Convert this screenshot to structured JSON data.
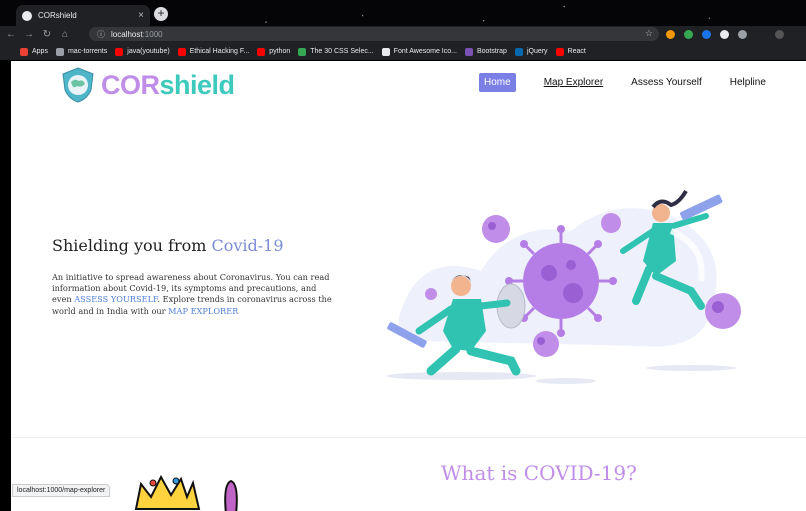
{
  "browser": {
    "tab_title": "CORshield",
    "tab_close": "×",
    "new_tab": "+",
    "url_host": "localhost",
    "url_rest": ":1000",
    "status_url": "localhost:1000/map-explorer",
    "nav_back": "←",
    "nav_forward": "→",
    "nav_reload": "↻",
    "nav_home": "⌂",
    "star": "☆"
  },
  "bookmarks": [
    {
      "label": "Apps",
      "color": "#ea4335"
    },
    {
      "label": "mac-torrents",
      "color": "#9aa0a6"
    },
    {
      "label": "java(youtube)",
      "color": "#ff0000"
    },
    {
      "label": "Ethical Hacking F...",
      "color": "#ff0000"
    },
    {
      "label": "python",
      "color": "#ff0000"
    },
    {
      "label": "The 30 CSS Selec...",
      "color": "#34a853"
    },
    {
      "label": "Font Awesome Ico...",
      "color": "#e8eaed"
    },
    {
      "label": "Bootstrap",
      "color": "#7952b3"
    },
    {
      "label": "jQuery",
      "color": "#0769ad"
    },
    {
      "label": "React",
      "color": "#ff0000"
    }
  ],
  "site": {
    "logo_part1": "COR",
    "logo_part2": "shield",
    "nav": {
      "home": "Home",
      "map": "Map Explorer",
      "assess": "Assess Yourself",
      "helpline": "Helpline"
    },
    "hero": {
      "title_main": "Shielding you from ",
      "title_accent": "Covid-19",
      "desc_1": "An initiative to spread awareness about Coronavirus. You can read information about Covid-19, its symptoms and precautions, and even ",
      "desc_link1": "ASSESS YOURSELF",
      "desc_2": ". Explore trends in coronavirus across the world and in India with our ",
      "desc_link2": "MAP EXPLORER"
    },
    "section_title": "What is COVID-19?"
  },
  "colors": {
    "accent_purple": "#c08ee8",
    "accent_teal": "#3ec9bd",
    "nav_active": "#7b7ee4",
    "link_blue": "#4e7fd6"
  }
}
